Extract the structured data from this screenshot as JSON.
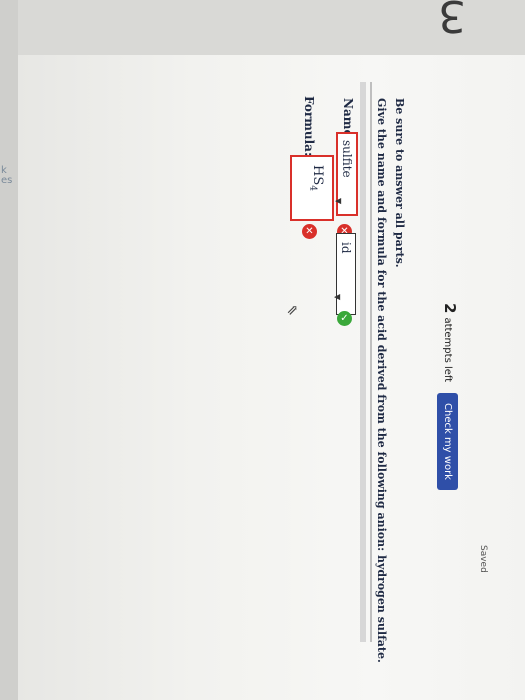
{
  "question_number": "3",
  "status": {
    "saved_label": "Saved"
  },
  "side_strip": {
    "label_k": "k",
    "label_es": "es"
  },
  "header": {
    "attempts_count": "2",
    "attempts_label": "attempts left",
    "check_button_label": "Check my work"
  },
  "question": {
    "be_sure": "Be sure to answer all parts.",
    "instruction": "Give the name and formula for the acid derived from the following anion: hydrogen sulfate.",
    "name_label": "Name:",
    "name_select_1_value": "sulfite",
    "name_select_2_value": "id",
    "formula_label": "Formula:",
    "formula_value": "HS",
    "formula_subscript": "4"
  },
  "colors": {
    "accent": "#2f4fa8",
    "error": "#d9302a",
    "correct": "#3aa83a"
  }
}
